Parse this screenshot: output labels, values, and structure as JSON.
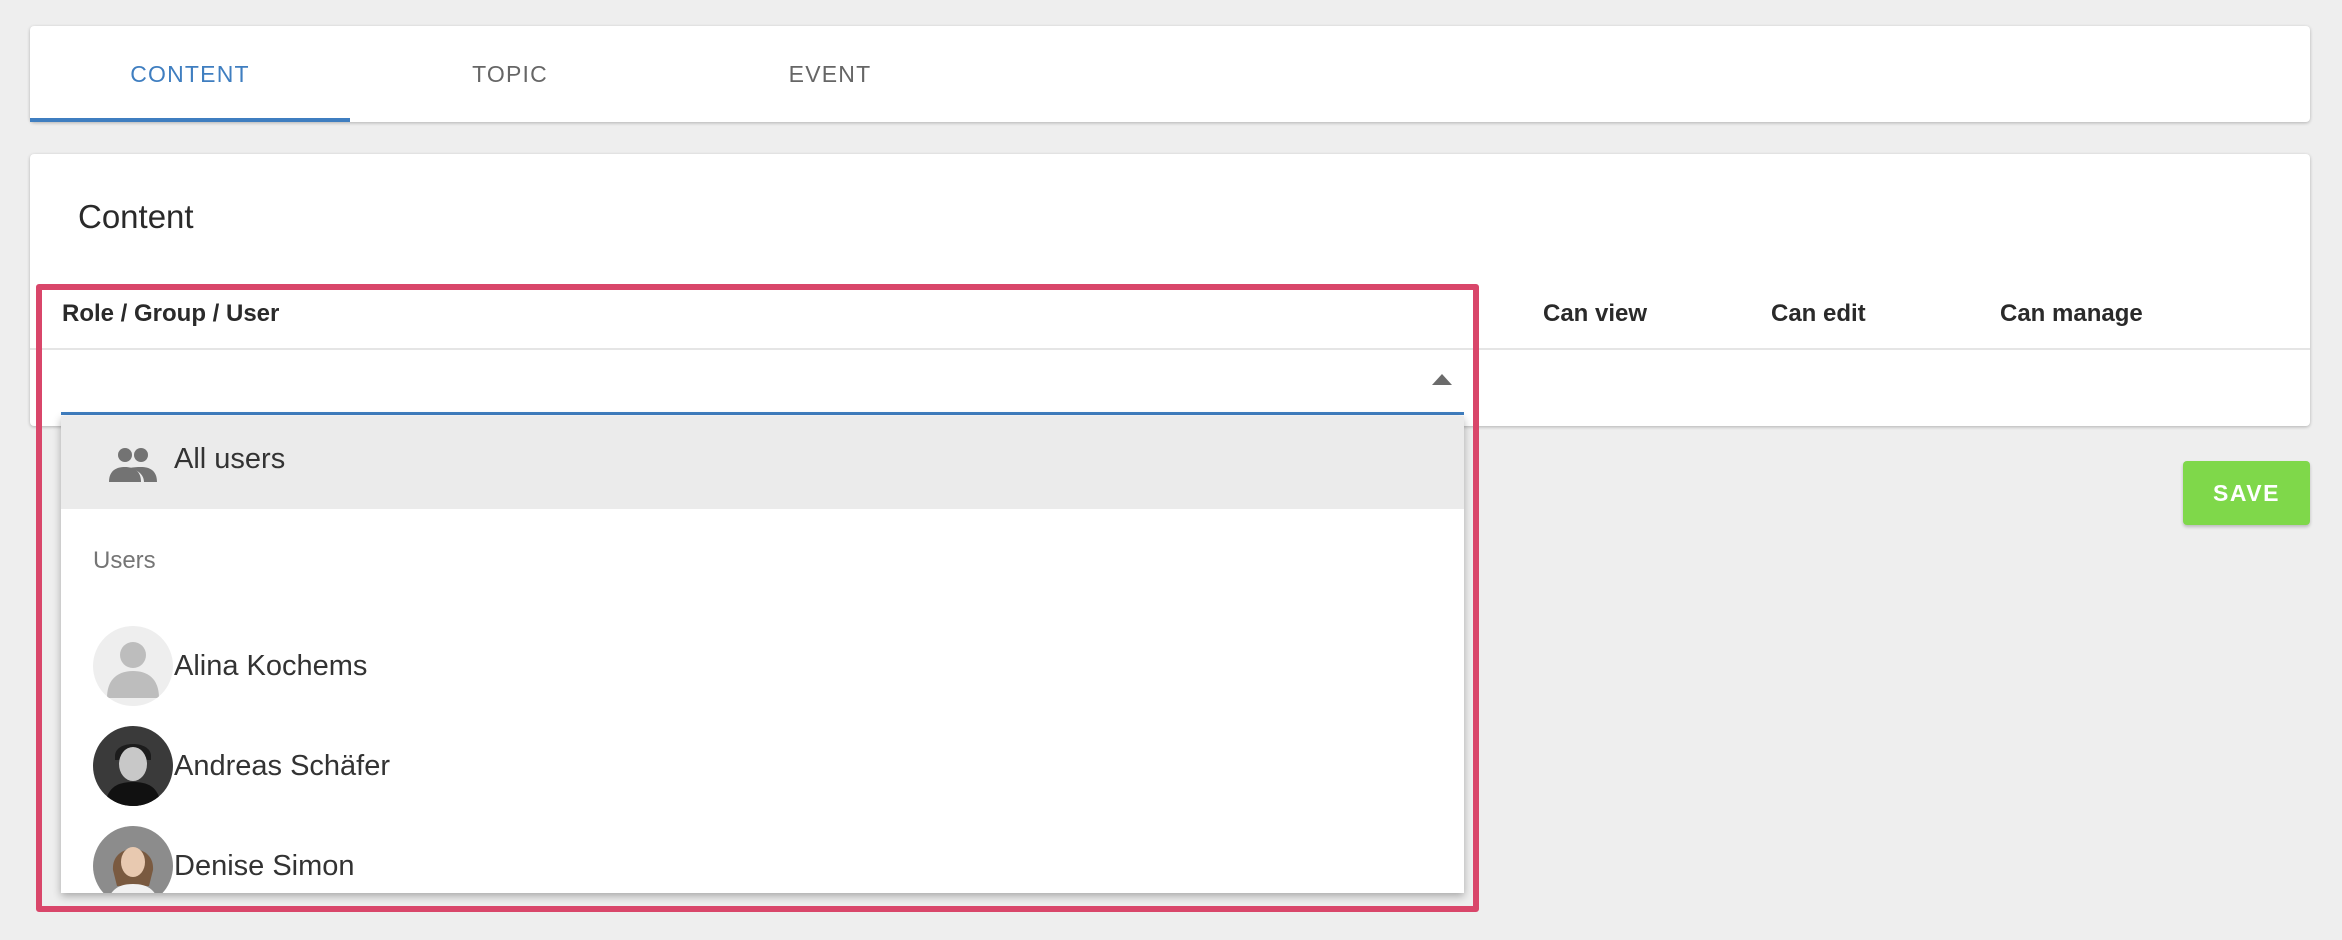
{
  "tabs": [
    {
      "label": "CONTENT",
      "active": true
    },
    {
      "label": "TOPIC",
      "active": false
    },
    {
      "label": "EVENT",
      "active": false
    }
  ],
  "card": {
    "title": "Content",
    "columns": [
      "Role / Group / User",
      "Can view",
      "Can edit",
      "Can manage"
    ]
  },
  "select": {
    "value": "",
    "arrow_icon": "arrow-drop-up-icon"
  },
  "dropdown": {
    "all_option": {
      "label": "All users",
      "icon": "group-icon"
    },
    "group_label": "Users",
    "users": [
      {
        "name": "Alina Kochems",
        "avatar": "default-avatar"
      },
      {
        "name": "Andreas Schäfer",
        "avatar": "photo-avatar"
      },
      {
        "name": "Denise Simon",
        "avatar": "photo-avatar"
      }
    ]
  },
  "actions": {
    "save_label": "SAVE"
  },
  "colors": {
    "accent": "#3f7ec0",
    "save_button": "#7fd84a",
    "highlight": "#d9466a",
    "background": "#eeeeee"
  }
}
